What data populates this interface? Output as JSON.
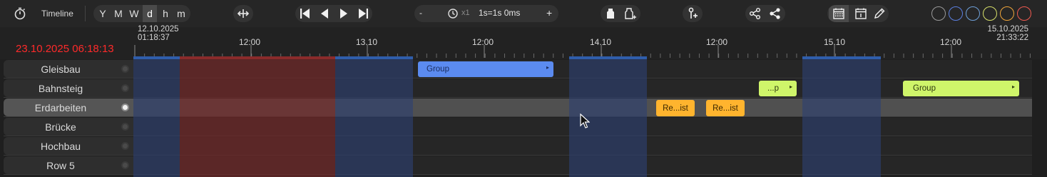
{
  "toolbar": {
    "timeline_label": "Timeline",
    "zoom_levels": [
      "Y",
      "M",
      "W",
      "d",
      "h",
      "m"
    ],
    "active_zoom": "d",
    "speed": {
      "minus": "-",
      "multiplier": "x1",
      "value": "1s=1s 0ms",
      "plus": "+"
    },
    "color_filters": [
      "#9a9a9a",
      "#5b7fe0",
      "#6fa0d8",
      "#d8e06a",
      "#f0a53a",
      "#f05a50"
    ]
  },
  "ruler": {
    "current_time": "23.10.2025 06:18:13",
    "range_start_date": "12.10.2025",
    "range_start_time": "01:18:37",
    "range_end_date": "15.10.2025",
    "range_end_time": "21:33:22",
    "tick_labels": [
      "12:00",
      "13.10",
      "12:00",
      "14.10",
      "12:00",
      "15.10",
      "12:00"
    ]
  },
  "rows": [
    {
      "name": "Gleisbau",
      "active": false
    },
    {
      "name": "Bahnsteig",
      "active": false
    },
    {
      "name": "Erdarbeiten",
      "active": true
    },
    {
      "name": "Brücke",
      "active": false
    },
    {
      "name": "Hochbau",
      "active": false
    },
    {
      "name": "Row 5",
      "active": false
    }
  ],
  "bars": {
    "gleisbau_group": {
      "label": "Group",
      "arrow": "▸"
    },
    "bahnsteig_p": {
      "label": "...p",
      "arrow": "▸"
    },
    "bahnsteig_group": {
      "label": "Group",
      "arrow": "▸"
    },
    "erdarbeiten_1": {
      "label": "Re...ist"
    },
    "erdarbeiten_2": {
      "label": "Re...ist"
    }
  },
  "colors": {
    "current_time": "#ff2a2a",
    "weekend": "#2f5dab",
    "group_blue": "#5b8bf0",
    "group_green": "#cff56a",
    "item_orange": "#ffb42e"
  }
}
